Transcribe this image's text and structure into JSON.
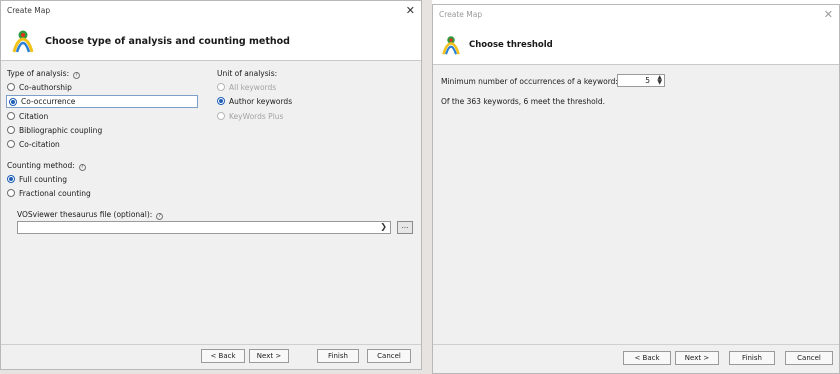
{
  "left_dialog": {
    "window_title": "Create Map",
    "header_title": "Choose type of analysis and counting method",
    "type_label": "Type of analysis:",
    "type_options": [
      "Co-authorship",
      "Co-occurrence",
      "Citation",
      "Bibliographic coupling",
      "Co-citation"
    ],
    "type_selected_index": 1,
    "unit_label": "Unit of analysis:",
    "unit_options": [
      "All keywords",
      "Author keywords",
      "KeyWords Plus"
    ],
    "unit_selected_index": 1,
    "counting_label": "Counting method:",
    "counting_options": [
      "Full counting",
      "Fractional counting"
    ],
    "counting_selected_index": 0,
    "thesaurus_label": "VOSviewer thesaurus file (optional):",
    "thesaurus_value": "",
    "browse_label": "...",
    "buttons": {
      "back": "< Back",
      "next": "Next >",
      "finish": "Finish",
      "cancel": "Cancel"
    }
  },
  "right_dialog": {
    "window_title": "Create Map",
    "header_title": "Choose threshold",
    "threshold_label": "Minimum number of occurrences of a keyword:",
    "threshold_value": "5",
    "result_text": "Of the 363 keywords, 6 meet the threshold.",
    "buttons": {
      "back": "< Back",
      "next": "Next >",
      "finish": "Finish",
      "cancel": "Cancel"
    }
  },
  "icons": {
    "close": "close-icon",
    "logo": "vosviewer-logo-icon",
    "help": "help-icon",
    "dropdown": "chevron-down-icon",
    "spinner": "spinner-arrows-icon"
  },
  "colors": {
    "accent": "#1f5fb5",
    "dialog_bg": "#f0f0f0",
    "header_bg": "#ffffff"
  }
}
